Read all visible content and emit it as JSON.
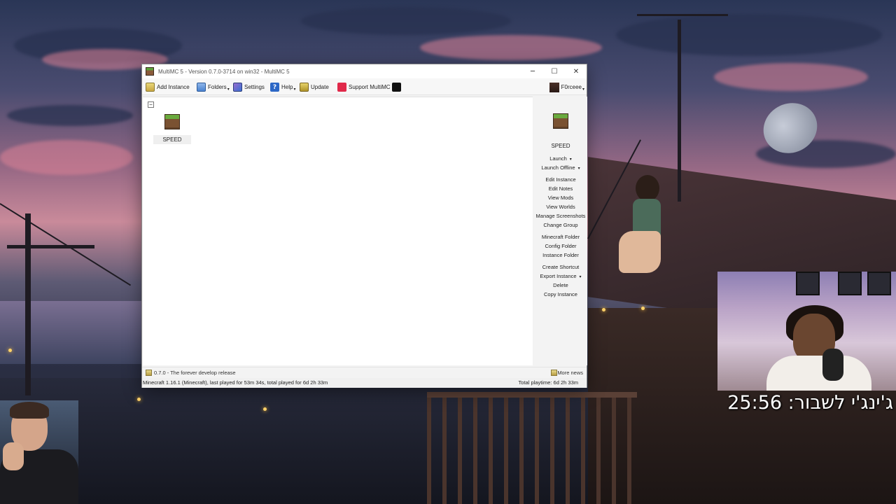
{
  "window": {
    "title": "MultiMC 5 - Version 0.7.0-3714 on win32 - MultiMC 5",
    "minimize_glyph": "─",
    "maximize_glyph": "☐",
    "close_glyph": "✕"
  },
  "toolbar": {
    "add_instance": "Add Instance",
    "folders": "Folders",
    "settings": "Settings",
    "help": "Help",
    "help_glyph": "?",
    "update": "Update",
    "support": "Support MultiMC",
    "dropdown_glyph": "▾",
    "account": "F0rceee"
  },
  "icons": {
    "add_instance": "add-instance-icon",
    "folders": "folder-icon",
    "settings": "settings-icon",
    "help": "help-icon",
    "update": "update-icon",
    "support": "patreon-icon",
    "cat": "cat-icon",
    "instance": "grass-block-icon"
  },
  "instances": {
    "group_toggle": "−",
    "items": [
      {
        "name": "SPEED"
      }
    ]
  },
  "sidebar": {
    "selected_name": "SPEED",
    "launch": "Launch",
    "launch_offline": "Launch Offline",
    "edit_instance": "Edit Instance",
    "edit_notes": "Edit Notes",
    "view_mods": "View Mods",
    "view_worlds": "View Worlds",
    "manage_screenshots": "Manage Screenshots",
    "change_group": "Change Group",
    "minecraft_folder": "Minecraft Folder",
    "config_folder": "Config Folder",
    "instance_folder": "Instance Folder",
    "create_shortcut": "Create Shortcut",
    "export_instance": "Export Instance",
    "delete": "Delete",
    "copy_instance": "Copy Instance"
  },
  "news": {
    "headline": "0.7.0 - The forever develop release",
    "more": "More news"
  },
  "status": {
    "left": "Minecraft 1.16.1 (Minecraft), last played for 53m 34s, total played for 6d 2h 33m",
    "right": "Total playtime: 6d 2h 33m"
  },
  "overlay": {
    "timer": "ג'ינג'י לשבור: 25:56"
  },
  "colors": {
    "window_bg": "#f3f3f3",
    "list_bg": "#ffffff",
    "support_red": "#e0294a",
    "help_blue": "#2d68c6"
  }
}
